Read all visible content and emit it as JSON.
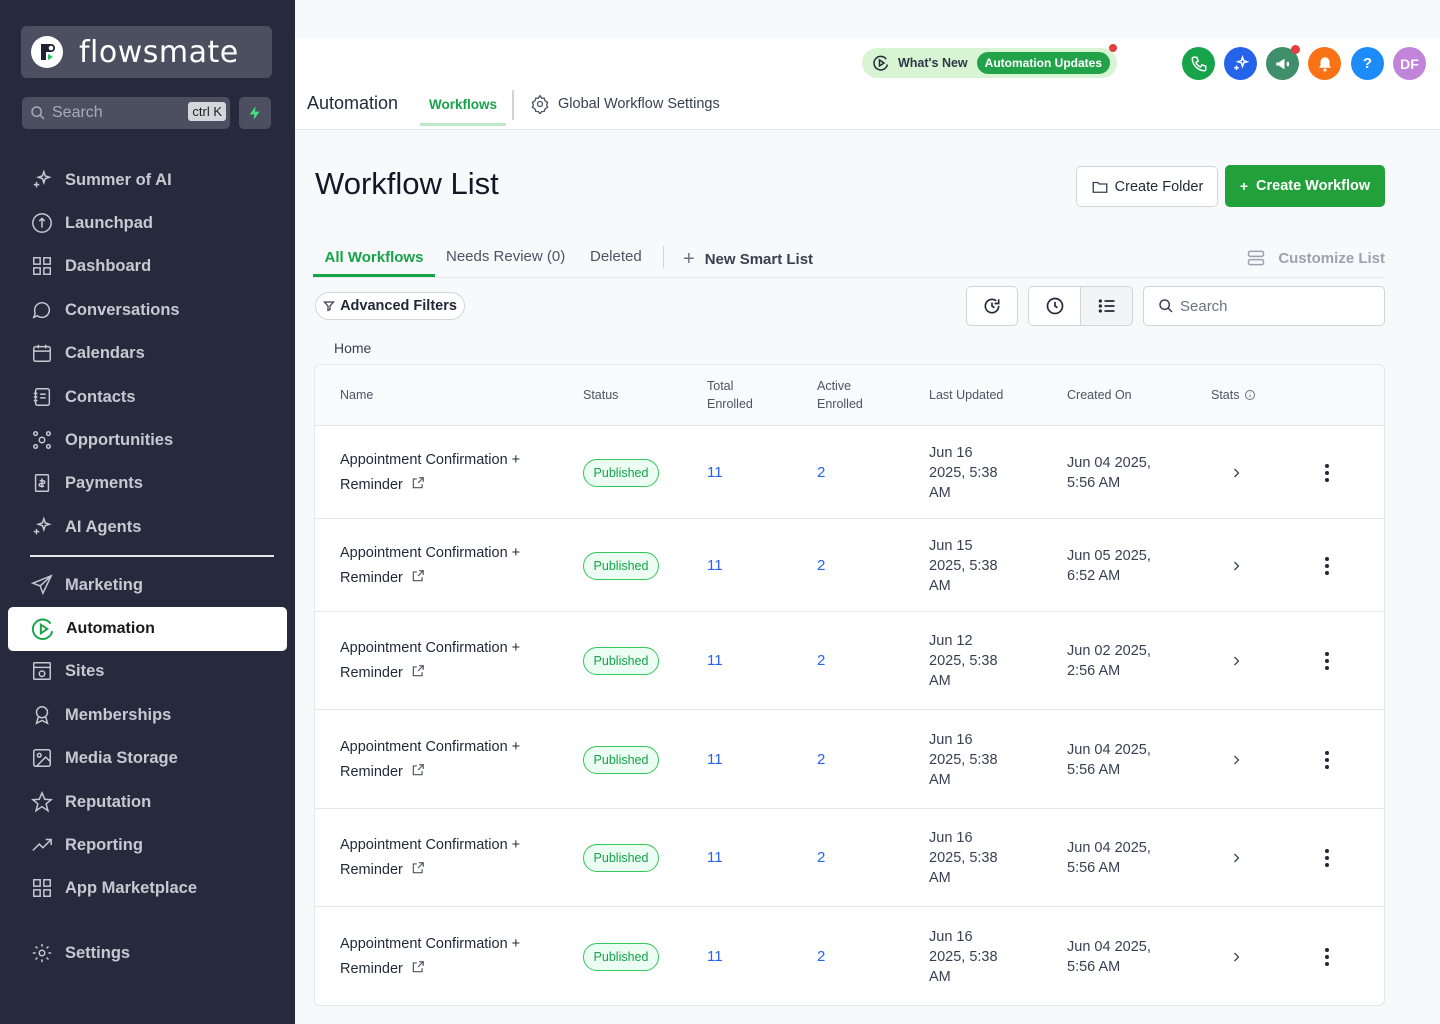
{
  "brand": {
    "name": "flowsmate"
  },
  "sidebar": {
    "search_placeholder": "Search",
    "search_shortcut": "ctrl K",
    "items": [
      {
        "label": "Summer of AI",
        "icon": "sparkle-icon"
      },
      {
        "label": "Launchpad",
        "icon": "rocket-icon"
      },
      {
        "label": "Dashboard",
        "icon": "grid-icon"
      },
      {
        "label": "Conversations",
        "icon": "chat-icon"
      },
      {
        "label": "Calendars",
        "icon": "calendar-icon"
      },
      {
        "label": "Contacts",
        "icon": "contacts-icon"
      },
      {
        "label": "Opportunities",
        "icon": "opportunities-icon"
      },
      {
        "label": "Payments",
        "icon": "payments-icon"
      },
      {
        "label": "AI Agents",
        "icon": "sparkle-icon"
      },
      {
        "label": "Marketing",
        "icon": "send-icon"
      },
      {
        "label": "Automation",
        "icon": "automation-icon"
      },
      {
        "label": "Sites",
        "icon": "sites-icon"
      },
      {
        "label": "Memberships",
        "icon": "award-icon"
      },
      {
        "label": "Media Storage",
        "icon": "image-icon"
      },
      {
        "label": "Reputation",
        "icon": "star-icon"
      },
      {
        "label": "Reporting",
        "icon": "trend-icon"
      },
      {
        "label": "App Marketplace",
        "icon": "grid-icon"
      },
      {
        "label": "Settings",
        "icon": "gear-icon"
      }
    ],
    "active": "Automation"
  },
  "topbar": {
    "whats_new": "What's New",
    "automation_updates": "Automation Updates",
    "avatar_initials": "DF",
    "help_label": "?",
    "colors": {
      "phone": "#16a34a",
      "sparkle": "#2563eb",
      "announce": "#3f8f6b",
      "bell": "#f97316",
      "help": "#1d8cf8",
      "avatar": "#c084d8"
    }
  },
  "topnav": {
    "title": "Automation",
    "tab_workflows": "Workflows",
    "tab_global": "Global Workflow Settings"
  },
  "main": {
    "title": "Workflow List",
    "create_folder": "Create Folder",
    "create_workflow": "Create Workflow",
    "tabs": {
      "all": "All Workflows",
      "review": "Needs Review (0)",
      "deleted": "Deleted",
      "smart": "New Smart List",
      "customize": "Customize List"
    },
    "advanced_filters": "Advanced Filters",
    "search_placeholder": "Search",
    "breadcrumb": "Home"
  },
  "table": {
    "headers": {
      "name": "Name",
      "status": "Status",
      "total1": "Total",
      "total2": "Enrolled",
      "active1": "Active",
      "active2": "Enrolled",
      "updated": "Last Updated",
      "created": "Created On",
      "stats": "Stats"
    },
    "rows": [
      {
        "name1": "Appointment Confirmation +",
        "name2": "Reminder",
        "status": "Published",
        "total": "11",
        "active": "2",
        "u1": "Jun 16",
        "u2": "2025, 5:38",
        "u3": "AM",
        "c1": "Jun 04 2025,",
        "c2": "5:56 AM"
      },
      {
        "name1": "Appointment Confirmation +",
        "name2": "Reminder",
        "status": "Published",
        "total": "11",
        "active": "2",
        "u1": "Jun 15",
        "u2": "2025, 5:38",
        "u3": "AM",
        "c1": "Jun 05 2025,",
        "c2": "6:52 AM"
      },
      {
        "name1": "Appointment Confirmation +",
        "name2": "Reminder",
        "status": "Published",
        "total": "11",
        "active": "2",
        "u1": "Jun 12",
        "u2": "2025, 5:38",
        "u3": "AM",
        "c1": "Jun 02 2025,",
        "c2": "2:56 AM"
      },
      {
        "name1": "Appointment Confirmation +",
        "name2": "Reminder",
        "status": "Published",
        "total": "11",
        "active": "2",
        "u1": "Jun 16",
        "u2": "2025, 5:38",
        "u3": "AM",
        "c1": "Jun 04 2025,",
        "c2": "5:56 AM"
      },
      {
        "name1": "Appointment Confirmation +",
        "name2": "Reminder",
        "status": "Published",
        "total": "11",
        "active": "2",
        "u1": "Jun 16",
        "u2": "2025, 5:38",
        "u3": "AM",
        "c1": "Jun 04 2025,",
        "c2": "5:56 AM"
      },
      {
        "name1": "Appointment Confirmation +",
        "name2": "Reminder",
        "status": "Published",
        "total": "11",
        "active": "2",
        "u1": "Jun 16",
        "u2": "2025, 5:38",
        "u3": "AM",
        "c1": "Jun 04 2025,",
        "c2": "5:56 AM"
      }
    ]
  }
}
